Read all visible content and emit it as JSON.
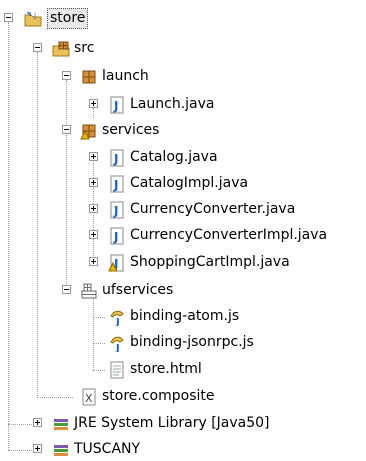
{
  "tree": {
    "project": {
      "label": "store",
      "icon": "project-folder-icon"
    },
    "src": {
      "label": "src",
      "icon": "source-folder-icon"
    },
    "launch": {
      "label": "launch",
      "icon": "package-icon"
    },
    "launch_java": {
      "label": "Launch.java",
      "icon": "java-file-icon"
    },
    "services": {
      "label": "services",
      "icon": "package-warning-icon"
    },
    "catalog": {
      "label": "Catalog.java",
      "icon": "java-file-icon"
    },
    "catalog_impl": {
      "label": "CatalogImpl.java",
      "icon": "java-file-icon"
    },
    "currency": {
      "label": "CurrencyConverter.java",
      "icon": "java-file-icon"
    },
    "currency_impl": {
      "label": "CurrencyConverterImpl.java",
      "icon": "java-file-icon"
    },
    "cart_impl": {
      "label": "ShoppingCartImpl.java",
      "icon": "java-file-warning-icon"
    },
    "ufservices": {
      "label": "ufservices",
      "icon": "folder-package-icon"
    },
    "binding_atom": {
      "label": "binding-atom.js",
      "icon": "javascript-file-icon"
    },
    "binding_jsonrpc": {
      "label": "binding-jsonrpc.js",
      "icon": "javascript-file-icon"
    },
    "store_html": {
      "label": "store.html",
      "icon": "html-file-icon"
    },
    "store_composite": {
      "label": "store.composite",
      "icon": "xml-file-icon"
    },
    "jre": {
      "label": "JRE System Library [Java50]",
      "icon": "library-icon"
    },
    "tuscany": {
      "label": "TUSCANY",
      "icon": "library-icon"
    }
  },
  "colors": {
    "selection": "#e8e8e8",
    "java": "#1f5fbf",
    "warning": "#f0b400",
    "package": "#b5651d"
  }
}
